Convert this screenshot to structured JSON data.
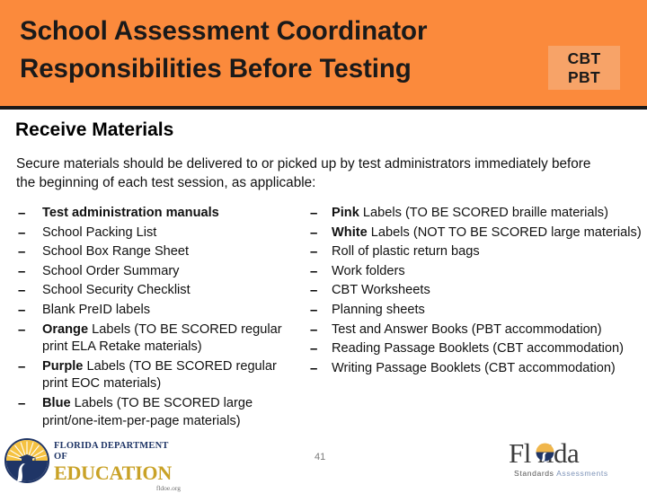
{
  "header": {
    "title_line1": "School Assessment Coordinator",
    "title_line2": "Responsibilities Before Testing",
    "badge": {
      "line1": "CBT",
      "line2": "PBT"
    },
    "background_color": "#fb8a3c",
    "badge_color": "#f7a368"
  },
  "body": {
    "section_heading": "Receive Materials",
    "intro": "Secure materials should be delivered to or picked up by test administrators immediately before the beginning of each test session, as applicable:",
    "bullet_marker": "–",
    "left_column": [
      {
        "bold": "Test administration manuals",
        "rest": ""
      },
      {
        "bold": "",
        "rest": "School Packing List"
      },
      {
        "bold": "",
        "rest": "School Box Range Sheet"
      },
      {
        "bold": "",
        "rest": "School Order Summary"
      },
      {
        "bold": "",
        "rest": "School Security Checklist"
      },
      {
        "bold": "",
        "rest": "Blank PreID labels"
      },
      {
        "bold": "Orange",
        "rest": " Labels (TO BE SCORED regular print ELA Retake materials)"
      },
      {
        "bold": "Purple",
        "rest": " Labels (TO BE SCORED regular print EOC materials)"
      },
      {
        "bold": "Blue",
        "rest": " Labels (TO BE SCORED large print/one-item-per-page materials)"
      }
    ],
    "right_column": [
      {
        "bold": "Pink",
        "rest": " Labels (TO BE SCORED braille materials)"
      },
      {
        "bold": "White",
        "rest": " Labels (NOT TO BE SCORED large materials)"
      },
      {
        "bold": "",
        "rest": "Roll of plastic return bags"
      },
      {
        "bold": "",
        "rest": "Work folders"
      },
      {
        "bold": "",
        "rest": "CBT Worksheets"
      },
      {
        "bold": "",
        "rest": "Planning sheets"
      },
      {
        "bold": "",
        "rest": "Test and Answer Books (PBT accommodation)"
      },
      {
        "bold": "",
        "rest": "Reading Passage Booklets (CBT accommodation)"
      },
      {
        "bold": "",
        "rest": "Writing Passage Booklets (CBT accommodation)"
      }
    ]
  },
  "footer": {
    "slide_number": "41",
    "fdoe_logo": {
      "line1": "FLORIDA DEPARTMENT OF",
      "line2": "EDUCATION",
      "line3": "fldoe.org"
    },
    "fsa_logo": {
      "word": "Fl rida",
      "sub_a": "Standards ",
      "sub_b": "Assessments"
    }
  }
}
